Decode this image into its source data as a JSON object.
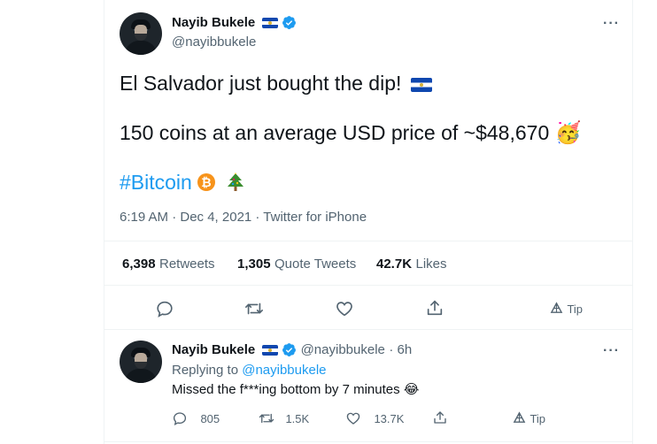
{
  "tweet": {
    "author_name": "Nayib Bukele",
    "author_handle": "@nayibbukele",
    "line1": "El Salvador just bought the dip!",
    "line2": "150 coins at an average USD price of ~$48,670",
    "hashtag": "#Bitcoin",
    "timestamp": "6:19 AM · Dec 4, 2021 · Twitter for iPhone",
    "stats": {
      "retweets_count": "6,398",
      "retweets_label": "Retweets",
      "quotes_count": "1,305",
      "quotes_label": "Quote Tweets",
      "likes_count": "42.7K",
      "likes_label": "Likes"
    },
    "actions": {
      "tip_label": "Tip"
    }
  },
  "reply": {
    "author_name": "Nayib Bukele",
    "author_handle": "@nayibbukele",
    "time": "· 6h",
    "replying_prefix": "Replying to",
    "replying_to": "@nayibbukele",
    "text": "Missed the f***ing bottom by 7 minutes",
    "actions": {
      "reply_count": "805",
      "retweet_count": "1.5K",
      "like_count": "13.7K",
      "tip_label": "Tip"
    }
  },
  "colors": {
    "accent": "#1d9bf0",
    "text": "#0f1419",
    "muted": "#536471",
    "divider": "#eff3f4"
  },
  "icons": [
    "more-icon",
    "verified-icon",
    "flag-icon",
    "party-emoji",
    "bitcoin-emoji",
    "tree-emoji",
    "reply-icon",
    "retweet-icon",
    "like-icon",
    "share-icon",
    "tip-icon",
    "laugh-emoji"
  ]
}
